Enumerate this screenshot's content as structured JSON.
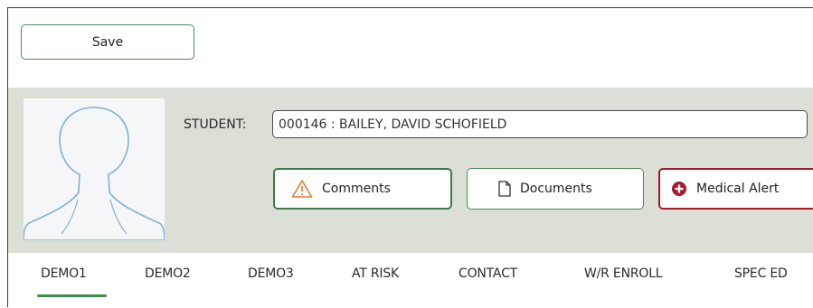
{
  "toolbar": {
    "save_label": "Save"
  },
  "student": {
    "label": "STUDENT:",
    "value": "000146 : BAILEY, DAVID SCHOFIELD",
    "photo": "silhouette-placeholder"
  },
  "actions": {
    "comments_label": "Comments",
    "comments_icon": "warning-triangle-icon",
    "documents_label": "Documents",
    "documents_icon": "document-icon",
    "medical_label": "Medical Alert",
    "medical_icon": "plus-circle-icon"
  },
  "tabs": [
    {
      "label": "DEMO1",
      "active": true
    },
    {
      "label": "DEMO2",
      "active": false
    },
    {
      "label": "DEMO3",
      "active": false
    },
    {
      "label": "AT RISK",
      "active": false
    },
    {
      "label": "CONTACT",
      "active": false
    },
    {
      "label": "W/R ENROLL",
      "active": false
    },
    {
      "label": "SPEC ED",
      "active": false
    }
  ],
  "colors": {
    "accent_green": "#3e8a4e",
    "alert_red": "#a8182a",
    "panel_bg": "#dcdfd6",
    "warning_orange": "#e07b39"
  }
}
